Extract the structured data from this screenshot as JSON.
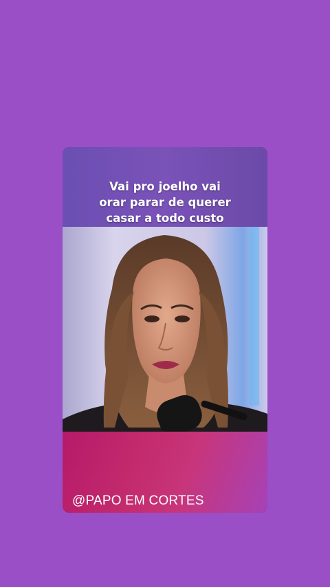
{
  "story": {
    "caption_lines": [
      "Vai pro joelho vai",
      "orar parar de querer",
      "casar a todo custo"
    ],
    "handle": "@PAPO EM CORTES"
  },
  "colors": {
    "background": "#9a4fc6",
    "caption_band": "#7a52b8",
    "footer_band": "#c2306e"
  },
  "icons": {
    "microphone": "microphone-icon"
  }
}
